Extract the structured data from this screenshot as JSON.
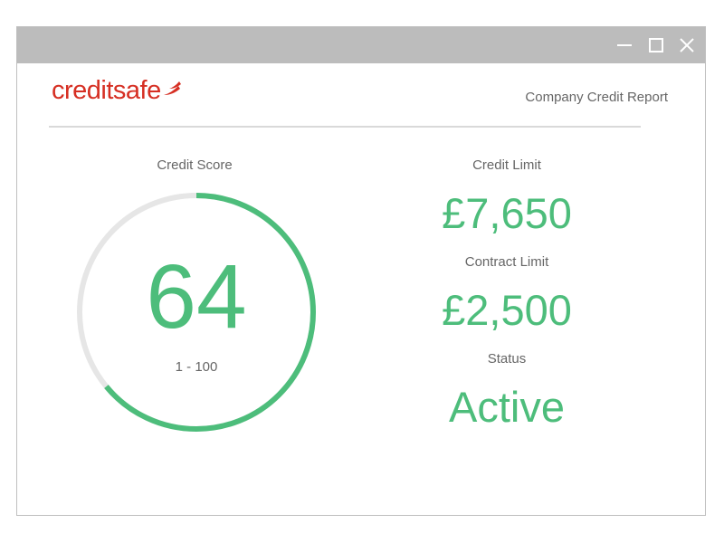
{
  "window": {
    "controls": {
      "minimize_icon": "minimize-icon",
      "maximize_icon": "maximize-icon",
      "close_icon": "close-icon"
    }
  },
  "header": {
    "logo_credit": "credit",
    "logo_safe": "safe",
    "report_title": "Company Credit Report"
  },
  "credit_score": {
    "label": "Credit Score",
    "value": "64",
    "range": "1 - 100",
    "fraction": 0.64
  },
  "credit_limit": {
    "label": "Credit Limit",
    "value": "£7,650"
  },
  "contract_limit": {
    "label": "Contract Limit",
    "value": "£2,500"
  },
  "status": {
    "label": "Status",
    "value": "Active"
  },
  "colors": {
    "accent_green": "#4dbd7b",
    "brand_red": "#d62f23",
    "gauge_track": "#e6e6e6",
    "titlebar": "#bcbcbc"
  }
}
